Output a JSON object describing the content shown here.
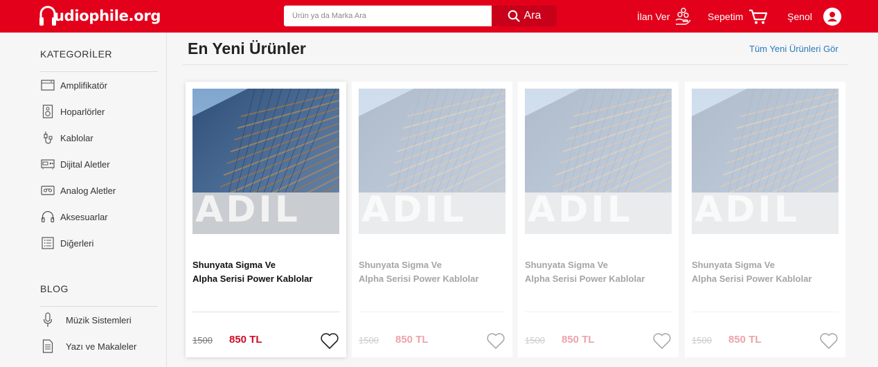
{
  "header": {
    "logo_text": "udiophile.org",
    "search_placeholder": "Ürün ya da Marka Ara",
    "search_button": "Ara",
    "ilan_ver": "İlan Ver",
    "sepetim": "Sepetim",
    "user": "Şenol",
    "brand_color": "#e3001b"
  },
  "sidebar": {
    "categories_title": "KATEGORİLER",
    "categories": [
      {
        "label": "Amplifikatör",
        "icon": "amplifier-icon"
      },
      {
        "label": "Hoparlörler",
        "icon": "speaker-icon"
      },
      {
        "label": "Kablolar",
        "icon": "cable-icon"
      },
      {
        "label": "Dijital Aletler",
        "icon": "digital-device-icon"
      },
      {
        "label": "Analog Aletler",
        "icon": "cassette-icon"
      },
      {
        "label": "Aksesuarlar",
        "icon": "headphones-icon"
      },
      {
        "label": "Diğerleri",
        "icon": "list-icon"
      }
    ],
    "blog_title": "BLOG",
    "blog": [
      {
        "label": "Müzik Sistemleri",
        "icon": "microphone-icon"
      },
      {
        "label": "Yazı ve Makaleler",
        "icon": "document-icon"
      }
    ]
  },
  "main": {
    "title": "En Yeni Ürünler",
    "see_all": "Tüm Yeni Ürünleri Gör",
    "products": [
      {
        "name_line1": "Shunyata Sigma Ve",
        "name_line2": "Alpha Serisi Power Kablolar",
        "old_price": "1500",
        "new_price": "850 TL",
        "image_text": "ADIL",
        "active": true
      },
      {
        "name_line1": "Shunyata Sigma Ve",
        "name_line2": "Alpha Serisi Power Kablolar",
        "old_price": "1500",
        "new_price": "850 TL",
        "image_text": "ADIL",
        "active": false
      },
      {
        "name_line1": "Shunyata Sigma Ve",
        "name_line2": "Alpha Serisi Power Kablolar",
        "old_price": "1500",
        "new_price": "850 TL",
        "image_text": "ADIL",
        "active": false
      },
      {
        "name_line1": "Shunyata Sigma Ve",
        "name_line2": "Alpha Serisi Power Kablolar",
        "old_price": "1500",
        "new_price": "850 TL",
        "image_text": "ADIL",
        "active": false
      }
    ]
  }
}
